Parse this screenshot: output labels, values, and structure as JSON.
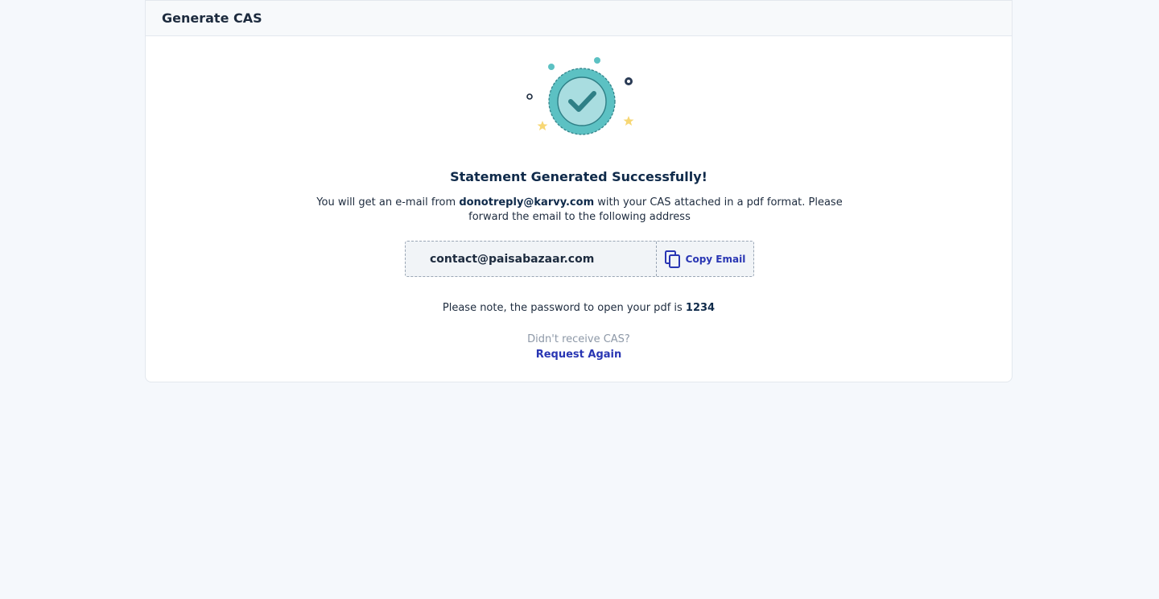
{
  "header": {
    "title": "Generate CAS"
  },
  "main": {
    "success_title": "Statement Generated Successfully!",
    "info_prefix": "You will get an e-mail from ",
    "sender_email": "donotreply@karvy.com",
    "info_suffix": " with your CAS attached in a pdf format. Please forward the email to the following address",
    "forward_email": "contact@paisabazaar.com",
    "copy_label": "Copy Email",
    "password_prefix": "Please note, the password to open your pdf is ",
    "password": "1234",
    "didnt_receive": "Didn't receive CAS?",
    "request_again": "Request Again"
  },
  "icons": {
    "success": "check-badge-icon",
    "copy": "copy-icon"
  },
  "colors": {
    "accent": "#2936b3",
    "badge": "#5cc1c3",
    "badge_inner": "#a9dde0",
    "check": "#2f7f86",
    "star": "#f7d774",
    "dark": "#0f2a4a"
  }
}
